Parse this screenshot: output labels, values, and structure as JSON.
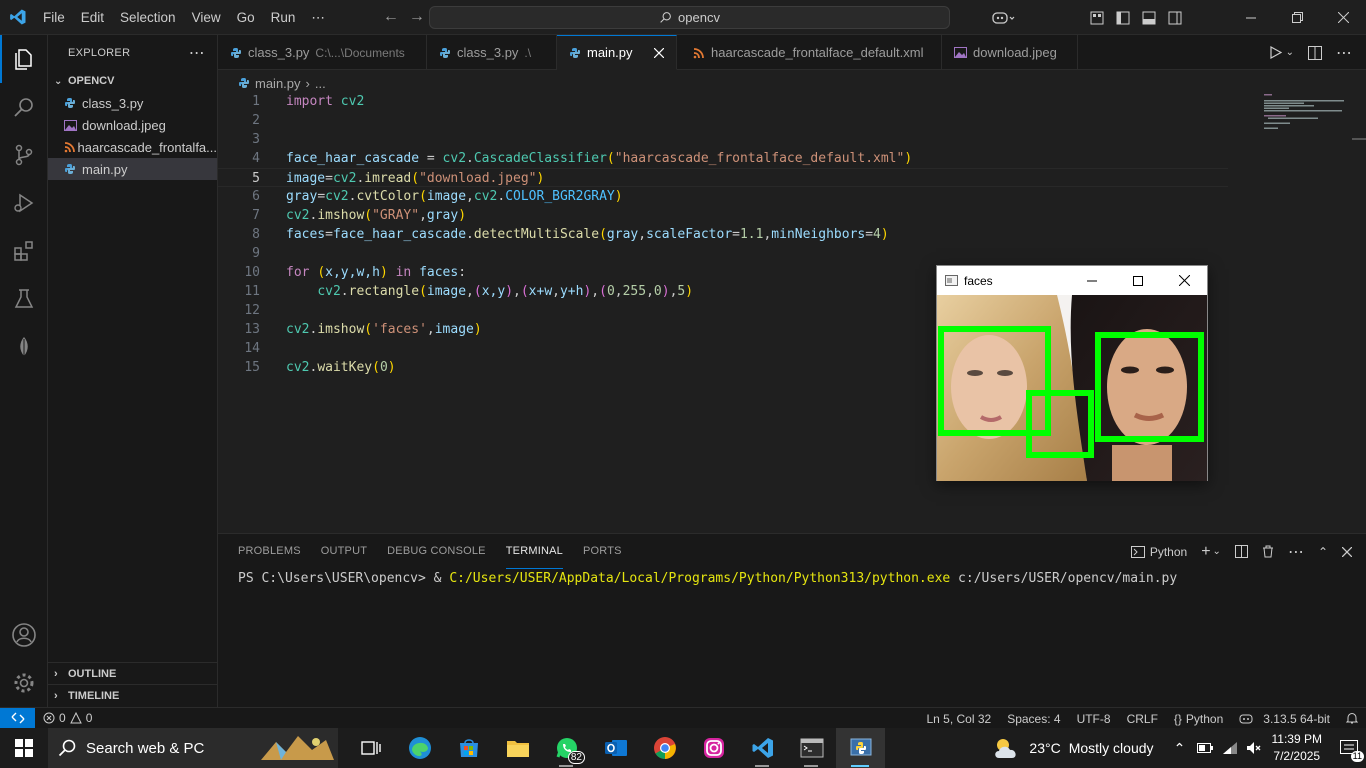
{
  "menu": [
    "File",
    "Edit",
    "Selection",
    "View",
    "Go",
    "Run",
    "⋯"
  ],
  "command_center": "opencv",
  "explorer": {
    "title": "EXPLORER",
    "folder": "OPENCV",
    "files": [
      {
        "name": "class_3.py",
        "type": "python"
      },
      {
        "name": "download.jpeg",
        "type": "image"
      },
      {
        "name": "haarcascade_frontalfa...",
        "type": "xml"
      },
      {
        "name": "main.py",
        "type": "python"
      }
    ],
    "outline": "OUTLINE",
    "timeline": "TIMELINE"
  },
  "tabs": [
    {
      "label": "class_3.py",
      "desc": "C:\\...\\Documents"
    },
    {
      "label": "class_3.py",
      "desc": ".\\"
    },
    {
      "label": "main.py",
      "desc": ""
    },
    {
      "label": "haarcascade_frontalface_default.xml",
      "desc": ""
    },
    {
      "label": "download.jpeg",
      "desc": ""
    }
  ],
  "breadcrumb": {
    "file": "main.py",
    "rest": "..."
  },
  "line_numbers": [
    "1",
    "2",
    "3",
    "4",
    "5",
    "6",
    "7",
    "8",
    "9",
    "10",
    "11",
    "12",
    "13",
    "14",
    "15"
  ],
  "code": {
    "l1_import": "import",
    "l1_mod": "cv2",
    "l4_var": "face_haar_cascade",
    "l4_eq": " = ",
    "l4_mod": "cv2",
    "l4_cls": "CascadeClassifier",
    "l4_str": "\"haarcascade_frontalface_default.xml\"",
    "l5_var": "image",
    "l5_mod": "cv2",
    "l5_fn": "imread",
    "l5_str": "\"download.jpeg\"",
    "l6_var": "gray",
    "l6_mod": "cv2",
    "l6_fn": "cvtColor",
    "l6_a1": "image",
    "l6_a2": "cv2",
    "l6_con": "COLOR_BGR2GRAY",
    "l7_mod": "cv2",
    "l7_fn": "imshow",
    "l7_str": "\"GRAY\"",
    "l7_a": "gray",
    "l8_var": "faces",
    "l8_obj": "face_haar_cascade",
    "l8_fn": "detectMultiScale",
    "l8_a1": "gray",
    "l8_k1": "scaleFactor",
    "l8_v1": "1.1",
    "l8_k2": "minNeighbors",
    "l8_v2": "4",
    "l10_for": "for",
    "l10_vars": "x,y,w,h",
    "l10_in": "in",
    "l10_it": "faces",
    "l11_mod": "cv2",
    "l11_fn": "rectangle",
    "l11_a1": "image",
    "l11_p1": "x,y",
    "l11_p2a": "x+w",
    "l11_p2b": "y+h",
    "l11_c1": "0",
    "l11_c2": "255",
    "l11_c3": "0",
    "l11_t": "5",
    "l13_mod": "cv2",
    "l13_fn": "imshow",
    "l13_str": "'faces'",
    "l13_a": "image",
    "l15_mod": "cv2",
    "l15_fn": "waitKey",
    "l15_a": "0"
  },
  "faces_window": {
    "title": "faces"
  },
  "panel": {
    "tabs": [
      "PROBLEMS",
      "OUTPUT",
      "DEBUG CONSOLE",
      "TERMINAL",
      "PORTS"
    ],
    "active_tab": "TERMINAL",
    "shell": "Python",
    "prompt": "PS C:\\Users\\USER\\opencv> & ",
    "exe": "C:/Users/USER/AppData/Local/Programs/Python/Python313/python.exe",
    "args": " c:/Users/USER/opencv/main.py"
  },
  "status": {
    "errors": "0",
    "warnings": "0",
    "position": "Ln 5, Col 32",
    "spaces": "Spaces: 4",
    "encoding": "UTF-8",
    "eol": "CRLF",
    "language": "Python",
    "interpreter": "3.13.5 64-bit"
  },
  "taskbar": {
    "search_placeholder": "Search web & PC",
    "whatsapp_badge": "82",
    "weather_temp": "23°C",
    "weather_desc": "Mostly cloudy",
    "time": "11:39 PM",
    "date": "7/2/2025",
    "notifications": "11"
  },
  "colors": {
    "accent": "#0078d4",
    "detection_box": "#00ff00"
  }
}
